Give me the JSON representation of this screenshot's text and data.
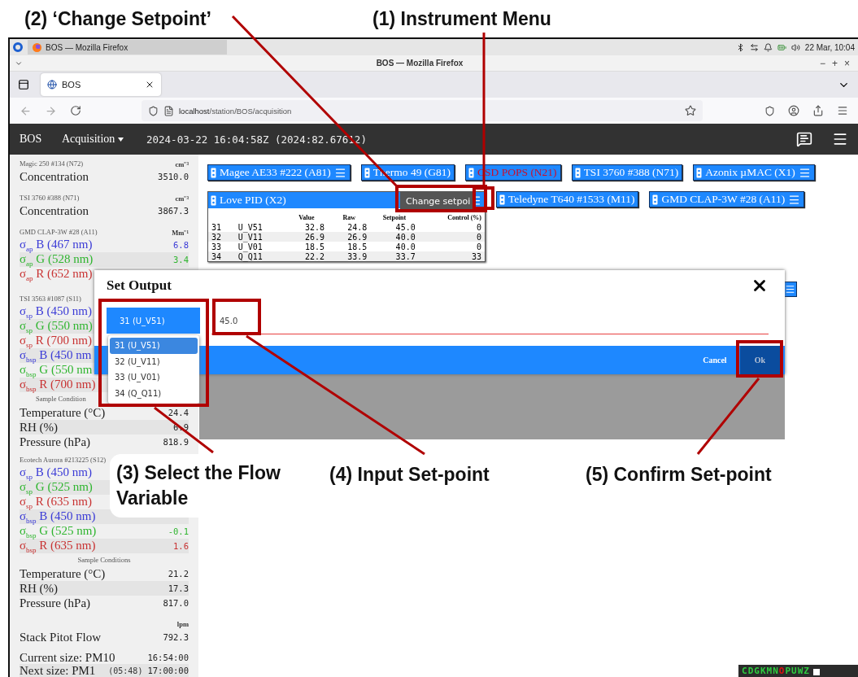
{
  "top_annotations": [
    {
      "text": "(2) ‘Change Setpoint’"
    },
    {
      "text": "(1) Instrument Menu"
    }
  ],
  "bottom_annotations": [
    {
      "text": "(3) Select the Flow Variable"
    },
    {
      "text": "(4) Input Set-point"
    },
    {
      "text": "(5) Confirm Set-point"
    }
  ],
  "taskbar": {
    "window_label": "BOS — Mozilla Firefox",
    "clock": "22 Mar, 10:04"
  },
  "window": {
    "title": "BOS — Mozilla Firefox",
    "controls": [
      "−",
      "+",
      "×"
    ]
  },
  "browser": {
    "tabs": [
      {
        "label": "BOS",
        "selected": true
      }
    ],
    "url": {
      "host": "localhost",
      "path": "/station/BOS/acquisition"
    }
  },
  "app_bar": {
    "brand": "BOS",
    "menu": "Acquisition",
    "timestamp": "2024-03-22 16:04:58Z (2024:82.67612)"
  },
  "sidebar": {
    "sections": [
      {
        "title": "Magic 250 #134 (N72)",
        "unit": "cm⁻³",
        "rows": [
          {
            "kind": "row",
            "label": "Concentration",
            "value": "3510.0"
          }
        ]
      },
      {
        "title": "TSI 3760 #388 (N71)",
        "unit": "cm⁻³",
        "rows": [
          {
            "kind": "row",
            "label": "Concentration",
            "value": "3867.3"
          }
        ]
      },
      {
        "title": "GMD CLAP-3W #28 (A11)",
        "unit": "Mm⁻¹",
        "rows": [
          {
            "kind": "row",
            "label": "σ$_{ap}$ B (467 nm)",
            "value": "6.8",
            "color": "#3a3ad6"
          },
          {
            "kind": "row",
            "label": "σ$_{ap}$ G (528 nm)",
            "value": "3.4",
            "color": "#2fb52f"
          },
          {
            "kind": "row",
            "label": "σ$_{ap}$ R (652 nm)",
            "color": "#c83232"
          }
        ]
      },
      {
        "title": "TSI 3563 #1087 (S11)",
        "rows": [
          {
            "kind": "row",
            "label": "σ$_{sp}$ B (450 nm)",
            "color": "#3a3ad6"
          },
          {
            "kind": "row",
            "label": "σ$_{sp}$ G (550 nm)",
            "color": "#2fb52f"
          },
          {
            "kind": "row",
            "label": "σ$_{sp}$ R (700 nm)",
            "color": "#c83232"
          },
          {
            "kind": "row",
            "label": "σ$_{bsp}$ B (450 nm",
            "color": "#3a3ad6"
          },
          {
            "kind": "row",
            "label": "σ$_{bsp}$ G (550 nm",
            "color": "#2fb52f"
          },
          {
            "kind": "row",
            "label": "σ$_{bsp}$ R (700 nm)",
            "color": "#c83232"
          },
          {
            "kind": "heading",
            "label": "Sample Condition"
          },
          {
            "kind": "row",
            "label": "Temperature (°C)",
            "value": "24.4"
          },
          {
            "kind": "row",
            "label": "RH (%)",
            "value": "6.9"
          },
          {
            "kind": "row",
            "label": "Pressure (hPa)",
            "value": "818.9"
          }
        ]
      },
      {
        "title": "Ecotech Aurora #213225 (S12)",
        "rows": [
          {
            "kind": "row",
            "label": "σ$_{sp}$ B (450 nm)",
            "color": "#3a3ad6"
          },
          {
            "kind": "row",
            "label": "σ$_{sp}$ G (525 nm)",
            "color": "#2fb52f"
          },
          {
            "kind": "row",
            "label": "σ$_{sp}$ R (635 nm)",
            "color": "#c83232"
          },
          {
            "kind": "row",
            "label": "σ$_{bsp}$ B (450 nm)",
            "color": "#3a3ad6"
          },
          {
            "kind": "row",
            "label": "σ$_{bsp}$ G (525 nm)",
            "value": "-0.1",
            "color": "#2fb52f"
          },
          {
            "kind": "row",
            "label": "σ$_{bsp}$ R (635 nm)",
            "value": "1.6",
            "color": "#c83232"
          },
          {
            "kind": "heading",
            "label": "Sample Conditions"
          },
          {
            "kind": "row",
            "label": "Temperature (°C)",
            "value": "21.2"
          },
          {
            "kind": "row",
            "label": "RH (%)",
            "value": "17.3"
          },
          {
            "kind": "row",
            "label": "Pressure (hPa)",
            "value": "817.0"
          }
        ]
      },
      {
        "unit": "lpm",
        "rows": [
          {
            "kind": "row",
            "label": "Stack Pitot Flow",
            "value": "792.3"
          }
        ]
      },
      {
        "rows": [
          {
            "kind": "row",
            "label": "Current size: PM10",
            "value": "16:54:00"
          },
          {
            "kind": "row",
            "label": "Next size: PM1",
            "note": "(05:48)",
            "value": "17:00:00"
          }
        ]
      }
    ]
  },
  "instruments": [
    [
      {
        "kind": "chip",
        "name": "Magee AE33 #222 (A81)",
        "menu": true,
        "alert": false
      },
      {
        "kind": "chip",
        "name": "Thermo 49 (G81)",
        "menu": false,
        "alert": false
      },
      {
        "kind": "chip",
        "name": "CSD POPS (N21)",
        "menu": false,
        "alert": true
      },
      {
        "kind": "chip",
        "name": "TSI 3760 #388 (N71)",
        "menu": false,
        "alert": false
      },
      {
        "kind": "chip",
        "name": "Azonix µMAC (X1)",
        "menu": true,
        "alert": false
      }
    ],
    [
      {
        "kind": "panel",
        "name": "Love PID (X2)",
        "menu": true,
        "alert": false,
        "tooltip": "Change setpoi",
        "table": {
          "columns": [
            "",
            "",
            "Value",
            "Raw",
            "Setpoint",
            "Control (%)"
          ],
          "rows": [
            [
              "31",
              "U_V51",
              "32.8",
              "24.8",
              "45.0",
              "0"
            ],
            [
              "32",
              "U_V11",
              "26.9",
              "26.9",
              "40.0",
              "0"
            ],
            [
              "33",
              "U_V01",
              "18.5",
              "18.5",
              "40.0",
              "0"
            ],
            [
              "34",
              "Q_Q11",
              "22.2",
              "33.9",
              "33.7",
              "33"
            ]
          ]
        }
      },
      {
        "kind": "chip",
        "name": "Teledyne T640 #1533 (M11)",
        "menu": false,
        "alert": false
      },
      {
        "kind": "chip",
        "name": "GMD CLAP-3W #28 (A11)",
        "menu": true,
        "alert": false
      }
    ]
  ],
  "dialog": {
    "title": "Set Output",
    "select": "31 (U_V51)",
    "value": "45.0",
    "options": [
      {
        "label": "31 (U_V51)",
        "selected": true
      },
      {
        "label": "32 (U_V11)",
        "selected": false
      },
      {
        "label": "33 (U_V01)",
        "selected": false
      },
      {
        "label": "34 (Q_Q11)",
        "selected": false
      }
    ],
    "buttons": [
      {
        "label": "Cancel",
        "primary": false
      },
      {
        "label": "Ok",
        "primary": true
      }
    ]
  },
  "status_letters": [
    {
      "text": "C",
      "color": "#2ecc40"
    },
    {
      "text": "D",
      "color": "#2ecc40"
    },
    {
      "text": "G",
      "color": "#2ecc40"
    },
    {
      "text": "K",
      "color": "#2ecc40"
    },
    {
      "text": "M",
      "color": "#2ecc40"
    },
    {
      "text": "N",
      "color": "#2ecc40"
    },
    {
      "text": "O",
      "color": "#dd1111"
    },
    {
      "text": "P",
      "color": "#2ecc40"
    },
    {
      "text": "U",
      "color": "#2ecc40"
    },
    {
      "text": "W",
      "color": "#2ecc40"
    },
    {
      "text": "Z",
      "color": "#2ecc40"
    }
  ]
}
